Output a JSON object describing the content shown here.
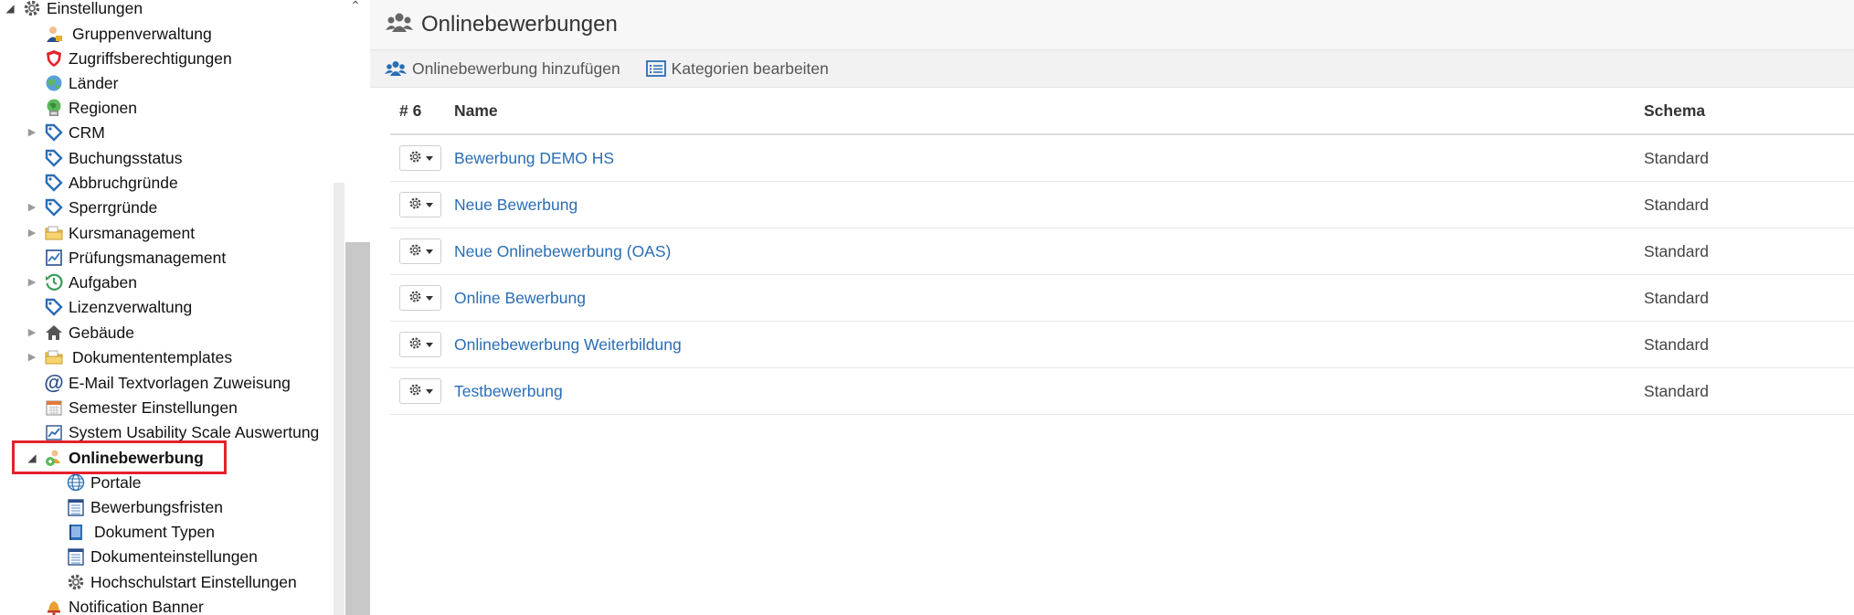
{
  "sidebar": {
    "items": [
      {
        "label": "Einstellungen",
        "icon": "gear-icon"
      },
      {
        "label": "Gruppenverwaltung",
        "icon": "user-group-icon"
      },
      {
        "label": "Zugriffsberechtigungen",
        "icon": "shield-icon"
      },
      {
        "label": "Länder",
        "icon": "globe-icon"
      },
      {
        "label": "Regionen",
        "icon": "globe-region-icon"
      },
      {
        "label": "CRM",
        "icon": "tag-icon"
      },
      {
        "label": "Buchungsstatus",
        "icon": "tag-icon"
      },
      {
        "label": "Abbruchgründe",
        "icon": "tag-icon"
      },
      {
        "label": "Sperrgründe",
        "icon": "tag-icon"
      },
      {
        "label": "Kursmanagement",
        "icon": "folder-icon"
      },
      {
        "label": "Prüfungsmanagement",
        "icon": "chart-doc-icon"
      },
      {
        "label": "Aufgaben",
        "icon": "history-icon"
      },
      {
        "label": "Lizenzverwaltung",
        "icon": "tag-icon"
      },
      {
        "label": "Gebäude",
        "icon": "house-icon"
      },
      {
        "label": "Dokumententemplates",
        "icon": "folder-icon"
      },
      {
        "label": "E-Mail Textvorlagen Zuweisung",
        "icon": "at-icon"
      },
      {
        "label": "Semester Einstellungen",
        "icon": "calendar-icon"
      },
      {
        "label": "System Usability Scale Auswertung",
        "icon": "line-chart-icon"
      },
      {
        "label": "Onlinebewerbung",
        "icon": "applicant-icon"
      },
      {
        "label": "Portale",
        "icon": "globe-grid-icon"
      },
      {
        "label": "Bewerbungsfristen",
        "icon": "list-doc-icon"
      },
      {
        "label": "Dokument Typen",
        "icon": "book-icon"
      },
      {
        "label": "Dokumenteinstellungen",
        "icon": "list-doc-icon"
      },
      {
        "label": "Hochschulstart Einstellungen",
        "icon": "gear-icon"
      },
      {
        "label": "Notification Banner",
        "icon": "bell-icon"
      }
    ]
  },
  "header": {
    "title": "Onlinebewerbungen"
  },
  "toolbar": {
    "add_label": "Onlinebewerbung hinzufügen",
    "categories_label": "Kategorien bearbeiten"
  },
  "table": {
    "count_header": "# 6",
    "name_header": "Name",
    "schema_header": "Schema",
    "rows": [
      {
        "name": "Bewerbung DEMO HS",
        "schema": "Standard"
      },
      {
        "name": "Neue Bewerbung",
        "schema": "Standard"
      },
      {
        "name": "Neue Onlinebewerbung (OAS)",
        "schema": "Standard"
      },
      {
        "name": "Online Bewerbung",
        "schema": "Standard"
      },
      {
        "name": "Onlinebewerbung Weiterbildung",
        "schema": "Standard"
      },
      {
        "name": "Testbewerbung",
        "schema": "Standard"
      }
    ]
  },
  "colors": {
    "link": "#2a6db5",
    "highlight": "#e3222b",
    "tag_icon": "#2a6db5",
    "shield": "#e3222b"
  }
}
